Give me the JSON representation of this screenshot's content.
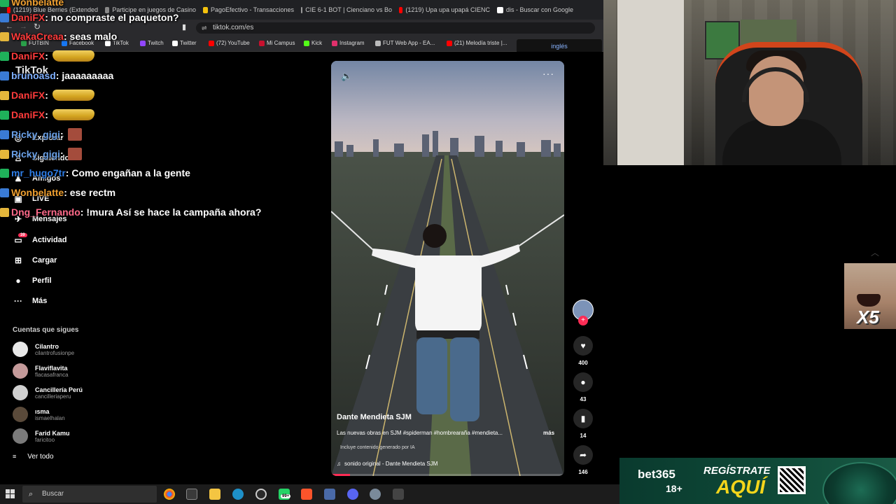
{
  "browser": {
    "tabs": [
      {
        "label": "(1219) Blue Berries (Extended",
        "color": "#ff0000"
      },
      {
        "label": "Participe en juegos de Casino",
        "color": "#888888"
      },
      {
        "label": "PagoEfectivo - Transacciones",
        "color": "#f4c20d"
      },
      {
        "label": "CIE 6-1 BOT | Cienciano vs Bo",
        "color": "#999999"
      },
      {
        "label": "(1219) Upa upa upapá CIENC",
        "color": "#ff0000"
      },
      {
        "label": "dis - Buscar con Google",
        "color": "#ffffff"
      }
    ],
    "url": "tiktok.com/es",
    "bookmarks": [
      {
        "label": "FUTBIN",
        "color": "#2aa04a"
      },
      {
        "label": "Facebook",
        "color": "#1877f2"
      },
      {
        "label": "TikTok",
        "color": "#ffffff"
      },
      {
        "label": "Twitch",
        "color": "#9146ff"
      },
      {
        "label": "Twitter",
        "color": "#ffffff"
      },
      {
        "label": "(72) YouTube",
        "color": "#ff0000"
      },
      {
        "label": "Mi Campus",
        "color": "#c8102e"
      },
      {
        "label": "Kick",
        "color": "#53fc18"
      },
      {
        "label": "Instagram",
        "color": "#e1306c"
      },
      {
        "label": "FUT Web App - EA...",
        "color": "#bbbbbb"
      },
      {
        "label": "(21) Melodía triste |...",
        "color": "#ff0000"
      }
    ],
    "language": "inglés"
  },
  "tiktok": {
    "logo": "TikTok",
    "nav": [
      {
        "label": "Explorar",
        "icon": "compass-icon",
        "glyph": "◎"
      },
      {
        "label": "Siguiendo",
        "icon": "following-icon",
        "glyph": "♙"
      },
      {
        "label": "Amigos",
        "icon": "friends-icon",
        "glyph": "♟"
      },
      {
        "label": "LIVE",
        "icon": "live-icon",
        "glyph": "▣"
      },
      {
        "label": "Mensajes",
        "icon": "messages-icon",
        "glyph": "✈"
      },
      {
        "label": "Actividad",
        "icon": "activity-icon",
        "glyph": "▭"
      },
      {
        "label": "Cargar",
        "icon": "upload-icon",
        "glyph": "⊞"
      },
      {
        "label": "Perfil",
        "icon": "profile-icon",
        "glyph": "●"
      },
      {
        "label": "Más",
        "icon": "more-icon",
        "glyph": "···"
      }
    ],
    "activity_badge": "39",
    "following_title": "Cuentas que sigues",
    "following": [
      {
        "name": "Cilantro",
        "handle": "cilantrofusionpe",
        "color": "#e8e8e8"
      },
      {
        "name": "Flaviflavita",
        "handle": "flacasafranca",
        "color": "#c49a9a"
      },
      {
        "name": "Cancillería Perú",
        "handle": "cancilleriaperu",
        "color": "#d0d0d0"
      },
      {
        "name": "ısma",
        "handle": "ismaelhalan",
        "color": "#5a4a3a"
      },
      {
        "name": "Farid Kamu",
        "handle": "faricitoo",
        "color": "#7a7a7a"
      }
    ],
    "see_all": "Ver todo",
    "video": {
      "author": "Dante Mendieta SJM",
      "description": "Las nuevas obras en SJM #spiderman #hombrearaña #mendieta...",
      "more": "más",
      "ai_label": "Incluye contenido generado por IA",
      "sound": "sonido original - Dante Mendieta SJM",
      "progress": 0.08
    },
    "actions": {
      "likes": "400",
      "comments": "43",
      "saves": "14",
      "shares": "146"
    }
  },
  "chat": [
    {
      "user": "Wonbelatte",
      "color": "#f0a030",
      "text": ""
    },
    {
      "user": "DaniFX",
      "color": "#ff3b3b",
      "text": ": no compraste el paqueton?"
    },
    {
      "user": "WakaCreaa",
      "color": "#ff3b3b",
      "text": ": seas malo"
    },
    {
      "user": "DaniFX",
      "color": "#ff3b3b",
      "text": ":"
    },
    {
      "user": "brunoasd",
      "color": "#7fb0ff",
      "text": ": jaaaaaaaaa"
    },
    {
      "user": "DaniFX",
      "color": "#ff3b3b",
      "text": ":"
    },
    {
      "user": "DaniFX",
      "color": "#ff3b3b",
      "text": ":"
    },
    {
      "user": "Ricky_gigi",
      "color": "#6aa0e6",
      "text": ":"
    },
    {
      "user": "Ricky_gigi",
      "color": "#6aa0e6",
      "text": ":"
    },
    {
      "user": "mr_hugo7tr",
      "color": "#2e7de6",
      "text": ": Como engañan a la gente"
    },
    {
      "user": "Wonbelatte",
      "color": "#f0a030",
      "text": ": ese rectm"
    },
    {
      "user": "Dng_Fernando",
      "color": "#ff6a8a",
      "text": ": !mura Así se hace la campaña ahora?"
    }
  ],
  "overlay": {
    "multiplier": "X5"
  },
  "ad": {
    "brand": "bet365",
    "age": "18+",
    "cta_top": "REGÍSTRATE",
    "cta_bottom": "AQUÍ"
  },
  "taskbar": {
    "search_placeholder": "Buscar",
    "badge": "99+"
  }
}
